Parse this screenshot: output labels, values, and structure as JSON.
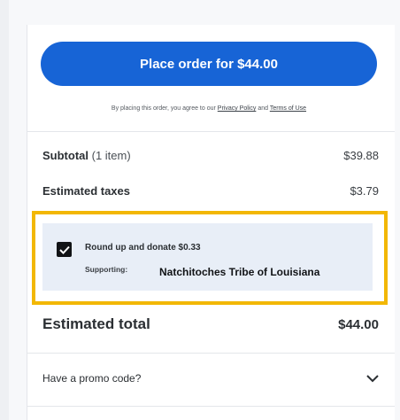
{
  "order": {
    "place_order_label": "Place order for $44.00",
    "agreement_prefix": "By placing this order, you agree to our",
    "privacy_link": "Privacy Policy",
    "agreement_and": "and",
    "terms_link": "Terms of Use"
  },
  "summary": {
    "subtotal_label": "Subtotal",
    "subtotal_items": "(1 item)",
    "subtotal_value": "$39.88",
    "taxes_label": "Estimated taxes",
    "taxes_value": "$3.79",
    "total_label": "Estimated total",
    "total_value": "$44.00"
  },
  "donation": {
    "checked": true,
    "title": "Round up and donate $0.33",
    "supporting_label": "Supporting:",
    "organization": "Natchitoches Tribe of Louisiana"
  },
  "promo": {
    "label": "Have a promo code?",
    "icon": "chevron-down-icon"
  },
  "colors": {
    "primary_button": "#1764d6",
    "highlight_border": "#f2b705",
    "donation_background": "#e8eef7"
  }
}
